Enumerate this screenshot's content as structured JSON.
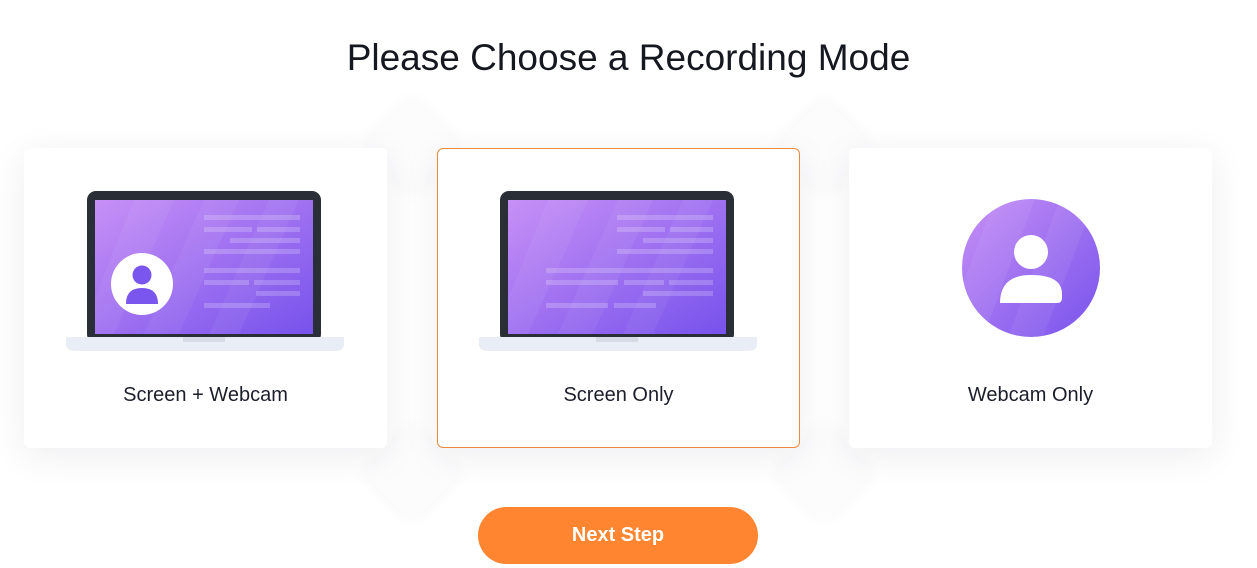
{
  "page": {
    "title": "Please Choose a Recording Mode"
  },
  "modes": [
    {
      "label": "Screen + Webcam",
      "icon": "laptop-with-webcam-icon"
    },
    {
      "label": "Screen Only",
      "icon": "laptop-screen-icon",
      "selected": true
    },
    {
      "label": "Webcam Only",
      "icon": "user-avatar-icon"
    }
  ],
  "next_button": {
    "label": "Next Step"
  },
  "colors": {
    "accent": "#ff8530",
    "selected_border": "#ef8a3c",
    "screen_purple_light": "#c58cf5",
    "screen_purple_dark": "#7b55ee",
    "laptop_frame": "#2a2e37",
    "laptop_base": "#e9eef6"
  }
}
